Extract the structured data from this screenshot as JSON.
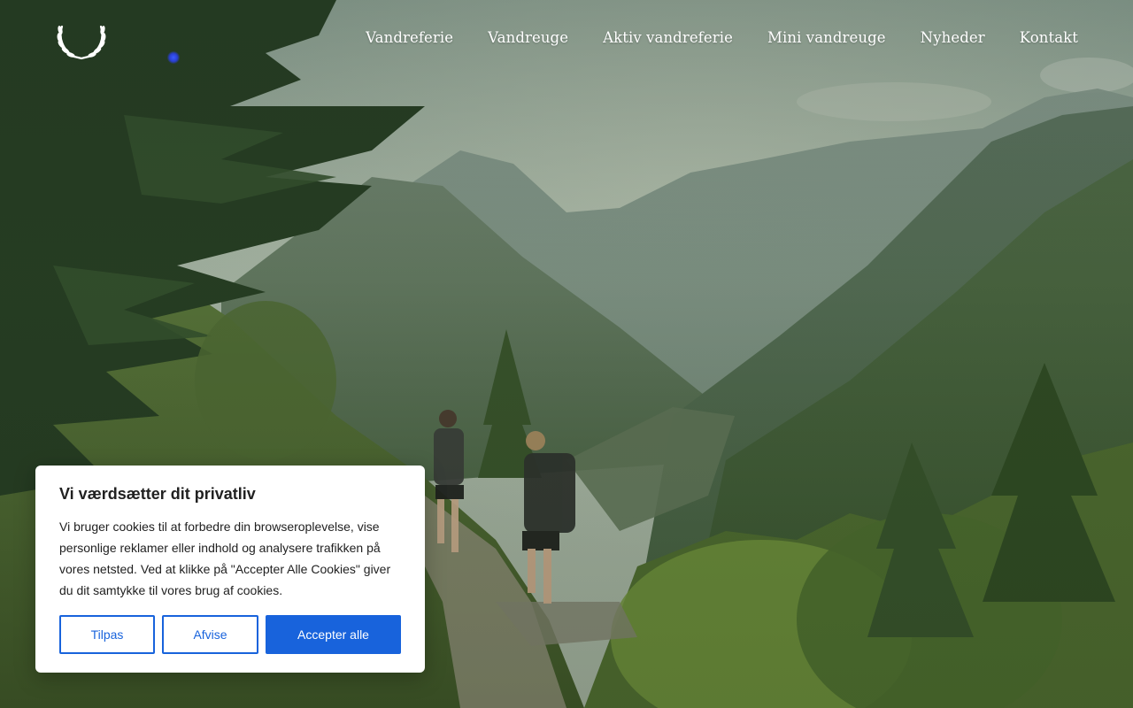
{
  "header": {
    "logo_icon": "laurel-wreath-icon",
    "nav": [
      {
        "label": "Vandreferie"
      },
      {
        "label": "Vandreuge"
      },
      {
        "label": "Aktiv vandreferie"
      },
      {
        "label": "Mini vandreuge"
      },
      {
        "label": "Nyheder"
      },
      {
        "label": "Kontakt"
      }
    ]
  },
  "hero": {
    "image": "mountain-valley-hikers-photo"
  },
  "cookie_banner": {
    "title": "Vi værdsætter dit privatliv",
    "body": "Vi bruger cookies til at forbedre din browseroplevelse, vise personlige reklamer eller indhold og analysere trafikken på vores netsted. Ved at klikke på \"Accepter Alle Cookies\" giver du dit samtykke til vores brug af cookies.",
    "buttons": {
      "customize": "Tilpas",
      "reject": "Afvise",
      "accept": "Accepter alle"
    },
    "accent_color": "#1863dc"
  }
}
